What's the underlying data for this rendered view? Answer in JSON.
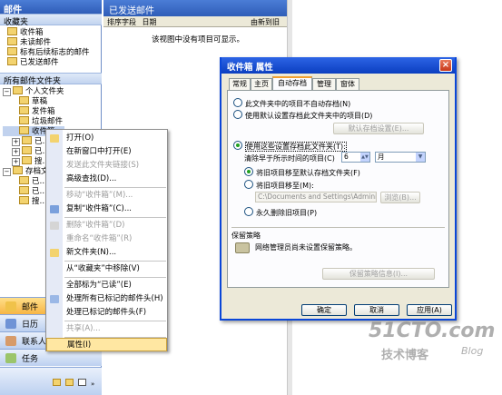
{
  "nav": {
    "header": "邮件",
    "favorites_title": "收藏夹",
    "favorites": [
      "收件箱",
      "未读邮件",
      "标有后续标志的邮件",
      "已发送邮件"
    ],
    "all_folders_title": "所有邮件文件夹",
    "tree_root": "个人文件夹",
    "tree": [
      "草稿",
      "发件箱",
      "垃圾邮件",
      "收件箱",
      "已…",
      "已…",
      "搜…"
    ],
    "archive": "存档文…",
    "archive_children": [
      "已…",
      "已…",
      "搜…"
    ],
    "buttons": [
      "邮件",
      "日历",
      "联系人",
      "任务"
    ]
  },
  "main": {
    "title": "已发送邮件",
    "columns": [
      "排序字段",
      "日期",
      "由新到旧"
    ],
    "empty_message": "该视图中没有项目可显示。"
  },
  "context_menu": {
    "items": [
      {
        "label": "打开(O)",
        "disabled": false
      },
      {
        "label": "在新窗口中打开(E)",
        "disabled": false
      },
      {
        "label": "发送此文件夹链接(S)",
        "disabled": true
      },
      {
        "label": "高级查找(D)...",
        "disabled": false
      },
      {
        "label": "移动“收件箱”(M)...",
        "disabled": true
      },
      {
        "label": "复制“收件箱”(C)...",
        "disabled": false
      },
      {
        "label": "删除“收件箱”(D)",
        "disabled": true
      },
      {
        "label": "重命名“收件箱”(R)",
        "disabled": true
      },
      {
        "label": "新文件夹(N)...",
        "disabled": false
      },
      {
        "label": "从“收藏夹”中移除(V)",
        "disabled": false
      },
      {
        "label": "全部标为“已读”(E)",
        "disabled": false
      },
      {
        "label": "处理所有已标记的邮件头(H)",
        "disabled": false
      },
      {
        "label": "处理已标记的邮件头(F)",
        "disabled": false
      },
      {
        "label": "共享(A)...",
        "disabled": true
      },
      {
        "label": "属性(I)",
        "disabled": false,
        "highlighted": true
      }
    ]
  },
  "dialog": {
    "title": "收件箱 属性",
    "tabs": [
      "常规",
      "主页",
      "自动存档",
      "管理",
      "窗体"
    ],
    "selected_tab": "自动存档",
    "opt_no_archive": "此文件夹中的项目不自动存档(N)",
    "opt_default": "使用默认设置存档此文件夹中的项目(D)",
    "btn_default_settings": "默认存档设置(E)...",
    "opt_custom": "使用这些设置存档此文件夹(T):",
    "clean_label": "清除早于所示时间的项目(C)",
    "clean_value": "6",
    "clean_unit": "月",
    "move_default": "将旧项目移至默认存档文件夹(F)",
    "move_to": "将旧项目移至(M):",
    "path_value": "C:\\Documents and Settings\\Admini",
    "browse": "浏览(B)...",
    "delete_perm": "永久删除旧项目(P)",
    "policy_title": "保留策略",
    "policy_text": "网络管理员尚未设置保留策略。",
    "policy_button": "保留策略信息(I)...",
    "ok": "确定",
    "cancel": "取消",
    "apply": "应用(A)"
  },
  "watermark": {
    "brand": "51CTO.com",
    "blog_cn": "技术博客",
    "blog_en": "Blog"
  },
  "colors": {
    "accent": "#0b3fc0",
    "nav_blue": "#2f5db8",
    "highlight": "#ffe7a2"
  }
}
